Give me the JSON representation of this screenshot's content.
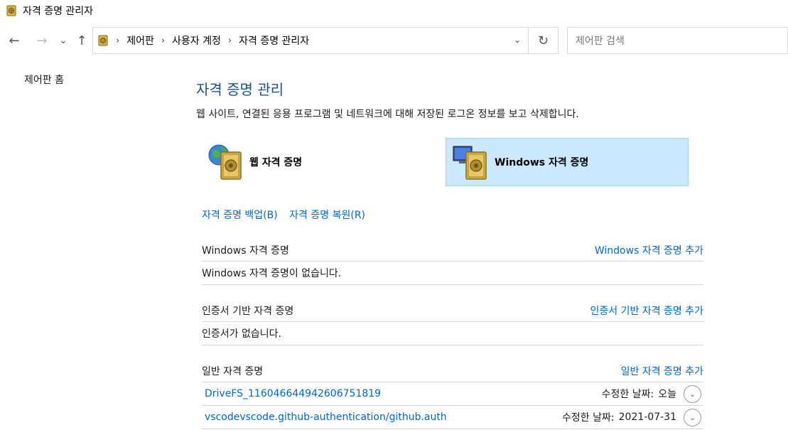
{
  "window": {
    "title": "자격 증명 관리자",
    "app_icon": "credential-vault-icon"
  },
  "nav": {
    "back": "←",
    "forward": "→",
    "recent": "⌄",
    "up": "↑"
  },
  "address": {
    "icon": "control-panel-vault-icon",
    "crumbs": [
      "제어판",
      "사용자 계정",
      "자격 증명 관리자"
    ],
    "separator": "›",
    "dropdown": "⌄",
    "refresh": "↻"
  },
  "search": {
    "placeholder": "제어판 검색"
  },
  "sidebar": {
    "home_label": "제어판 홈"
  },
  "main": {
    "title": "자격 증명 관리",
    "description": "웹 사이트, 연결된 응용 프로그램 및 네트워크에 대해 저장된 로그온 정보를 보고 삭제합니다.",
    "tiles": [
      {
        "label": "웹 자격 증명",
        "icon": "globe-vault-icon",
        "selected": false
      },
      {
        "label": "Windows 자격 증명",
        "icon": "monitor-vault-icon",
        "selected": true
      }
    ],
    "backup_link": "자격 증명 백업(B)",
    "restore_link": "자격 증명 복원(R)"
  },
  "sections": {
    "windows": {
      "title": "Windows 자격 증명",
      "add_link": "Windows 자격 증명 추가",
      "empty_text": "Windows 자격 증명이 없습니다."
    },
    "certificate": {
      "title": "인증서 기반 자격 증명",
      "add_link": "인증서 기반 자격 증명 추가",
      "empty_text": "인증서가 없습니다."
    },
    "generic": {
      "title": "일반 자격 증명",
      "add_link": "일반 자격 증명 추가",
      "items": [
        {
          "name": "DriveFS_116046644942606751819",
          "date_label": "수정한 날짜:",
          "date": "오늘"
        },
        {
          "name": "vscodevscode.github-authentication/github.auth",
          "date_label": "수정한 날짜:",
          "date": "2021-07-31"
        }
      ],
      "expand_glyph": "⌄"
    }
  },
  "colors": {
    "link": "#0066cc",
    "title": "#1e4e8c",
    "selected_tile_bg": "#cce8ff",
    "selected_tile_border": "#99d1ff"
  }
}
